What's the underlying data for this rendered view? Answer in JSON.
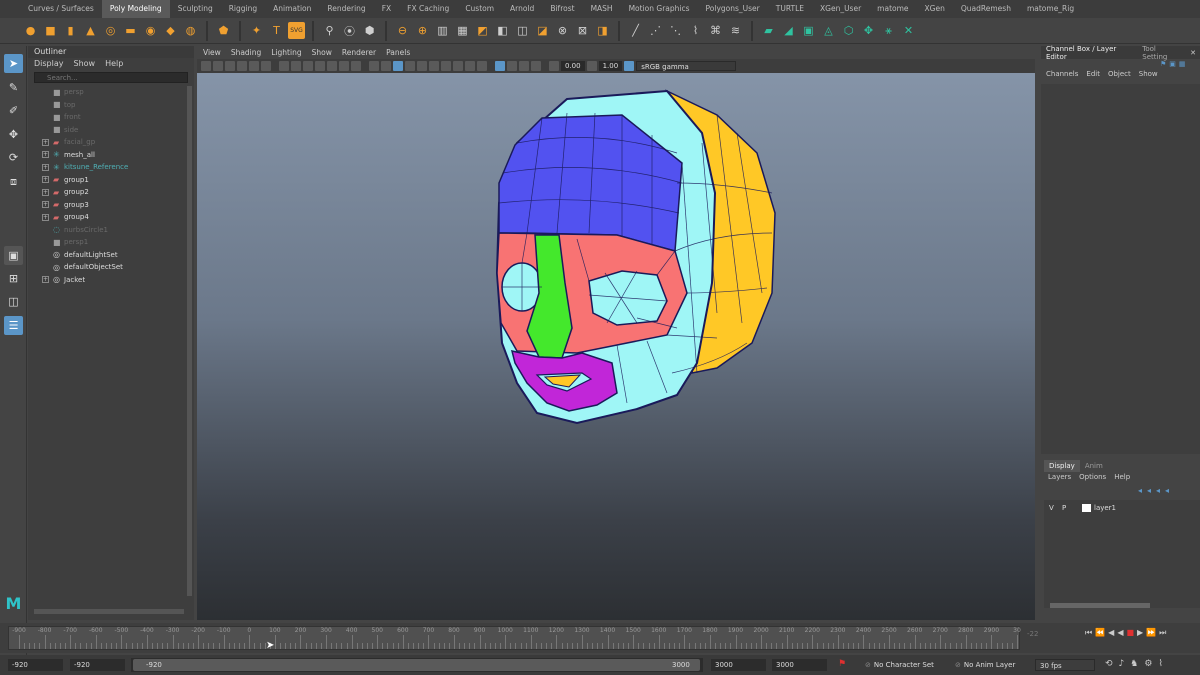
{
  "shelf_tabs": [
    "Curves / Surfaces",
    "Poly Modeling",
    "Sculpting",
    "Rigging",
    "Animation",
    "Rendering",
    "FX",
    "FX Caching",
    "Custom",
    "Arnold",
    "Bifrost",
    "MASH",
    "Motion Graphics",
    "Polygons_User",
    "TURTLE",
    "XGen_User",
    "matome",
    "XGen",
    "QuadRemesh",
    "matome_Rig"
  ],
  "shelf_active": "Poly Modeling",
  "outliner": {
    "title": "Outliner",
    "menu": [
      "Display",
      "Show",
      "Help"
    ],
    "search_placeholder": "Search...",
    "items": [
      {
        "label": "persp",
        "icon": "camera-icon",
        "expandable": false,
        "style": "dim"
      },
      {
        "label": "top",
        "icon": "camera-icon",
        "expandable": false,
        "style": "dim"
      },
      {
        "label": "front",
        "icon": "camera-icon",
        "expandable": false,
        "style": "dim"
      },
      {
        "label": "side",
        "icon": "camera-icon",
        "expandable": false,
        "style": "dim"
      },
      {
        "label": "facial_gp",
        "icon": "group-icon",
        "expandable": true,
        "style": "dim"
      },
      {
        "label": "mesh_all",
        "icon": "joint-icon",
        "expandable": true,
        "style": "norm"
      },
      {
        "label": "kitsune_Reference",
        "icon": "joint-icon",
        "expandable": true,
        "style": "dim"
      },
      {
        "label": "group1",
        "icon": "group-icon",
        "expandable": true,
        "style": "norm"
      },
      {
        "label": "group2",
        "icon": "group-icon",
        "expandable": true,
        "style": "norm"
      },
      {
        "label": "group3",
        "icon": "group-icon",
        "expandable": true,
        "style": "norm"
      },
      {
        "label": "group4",
        "icon": "group-icon",
        "expandable": true,
        "style": "norm"
      },
      {
        "label": "nurbsCircle1",
        "icon": "curve-icon",
        "expandable": false,
        "style": "dim"
      },
      {
        "label": "persp1",
        "icon": "camera-icon",
        "expandable": false,
        "style": "dim"
      },
      {
        "label": "defaultLightSet",
        "icon": "set-icon",
        "expandable": false,
        "style": "norm"
      },
      {
        "label": "defaultObjectSet",
        "icon": "set-icon",
        "expandable": false,
        "style": "norm"
      },
      {
        "label": "Jacket",
        "icon": "set-icon",
        "expandable": true,
        "style": "norm"
      }
    ]
  },
  "viewport": {
    "menu": [
      "View",
      "Shading",
      "Lighting",
      "Show",
      "Renderer",
      "Panels"
    ],
    "exposure": "0.00",
    "gamma": "1.00",
    "color_space": "sRGB gamma"
  },
  "channel_box": {
    "tabs": [
      "Channel Box / Layer Editor",
      "Tool Setting"
    ],
    "menu": [
      "Channels",
      "Edit",
      "Object",
      "Show"
    ]
  },
  "layer_editor": {
    "tabs": [
      "Display",
      "Anim"
    ],
    "menu": [
      "Layers",
      "Options",
      "Help"
    ],
    "layers": [
      {
        "v": "V",
        "p": "P",
        "name": "layer1"
      }
    ]
  },
  "timeline": {
    "ticks": [
      "-900",
      "-800",
      "-700",
      "-600",
      "-500",
      "-400",
      "-300",
      "-200",
      "-100",
      "0",
      "100",
      "200",
      "300",
      "400",
      "500",
      "600",
      "700",
      "800",
      "900",
      "1000",
      "1100",
      "1200",
      "1300",
      "1400",
      "1500",
      "1600",
      "1700",
      "1800",
      "1900",
      "2000",
      "2100",
      "2200",
      "2300",
      "2400",
      "2500",
      "2600",
      "2700",
      "2800",
      "2900",
      "30"
    ],
    "current_frame": "-22",
    "start": "-920",
    "range_start": "-920",
    "range_start_inner": "-920",
    "range_end_inner": "3000",
    "range_end": "3000",
    "end": "3000",
    "character_set": "No Character Set",
    "anim_layer": "No Anim Layer",
    "fps": "30 fps"
  },
  "colors": {
    "accent": "#5b96c8",
    "ui_bg": "#444444",
    "shelf_tab_active": "#5a5a5a"
  }
}
